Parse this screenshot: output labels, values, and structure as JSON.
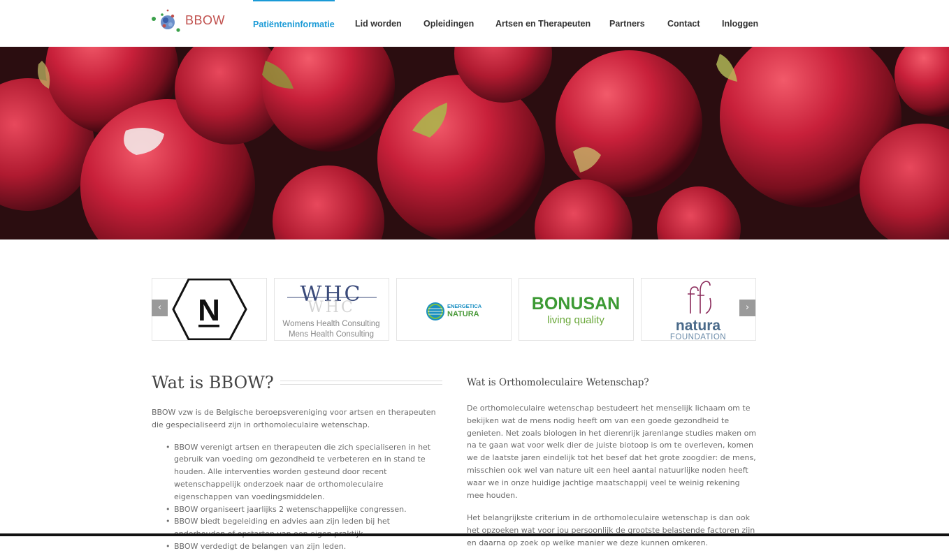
{
  "brand": {
    "name": "BBOW",
    "color": "#c0504d"
  },
  "nav": {
    "active_color": "#1a9ad6",
    "items": [
      {
        "label": "Patiënteninformatie",
        "active": true
      },
      {
        "label": "Lid worden"
      },
      {
        "label": "Opleidingen"
      },
      {
        "label": "Artsen en Therapeuten"
      },
      {
        "label": "Partners"
      },
      {
        "label": "Contact"
      },
      {
        "label": "Inloggen"
      }
    ]
  },
  "hero": {
    "subject": "red berries photo"
  },
  "carousel": {
    "prev_icon": "chevron-left-icon",
    "next_icon": "chevron-right-icon",
    "prev_label": "‹",
    "next_label": "›",
    "logos": [
      {
        "name": "N",
        "text": "N"
      },
      {
        "name": "WHC",
        "text": "WHC",
        "line1": "Womens Health Consulting",
        "line2": "Mens Health Consulting"
      },
      {
        "name": "Energetica Natura",
        "line1": "ENERGETICA",
        "line2": "NATURA"
      },
      {
        "name": "Bonusan",
        "line1": "BONUSAN",
        "line2": "living quality"
      },
      {
        "name": "Natura Foundation",
        "line1": "natura",
        "line2": "FOUNDATION"
      }
    ]
  },
  "left": {
    "title": "Wat is BBOW?",
    "intro": "BBOW vzw is de Belgische beroepsvereniging voor artsen en therapeuten die gespecialiseerd zijn in orthomoleculaire wetenschap.",
    "bullets": [
      "BBOW verenigt artsen en therapeuten die zich specialiseren in het gebruik van voeding om gezondheid te verbeteren en in stand te houden. Alle interventies worden gesteund door recent wetenschappelijk onderzoek naar de orthomoleculaire eigenschappen van voedingsmiddelen.",
      "BBOW organiseert jaarlijks 2 wetenschappelijke congressen.",
      "BBOW biedt begeleiding en advies aan zijn leden bij het onderhouden of opstarten van een eigen praktijk.",
      "BBOW verdedigt de belangen van zijn leden."
    ]
  },
  "right": {
    "title": "Wat is Orthomoleculaire Wetenschap?",
    "para1": "De orthomoleculaire wetenschap bestudeert het menselijk lichaam om te bekijken wat de mens nodig heeft om van een goede gezondheid te genieten. Net zoals biologen in het dierenrijk jarenlange studies maken om na te gaan wat voor welk dier de juiste biotoop is om te overleven, komen we de laatste jaren eindelijk tot het besef dat het grote zoogdier: de mens, misschien ook wel van nature uit een heel aantal natuurlijke noden heeft waar we in onze huidige jachtige maatschappij veel te weinig rekening mee houden.",
    "para2": "Het belangrijkste criterium in de orthomoleculaire wetenschap is dan ook het opzoeken wat voor jou persoonlijk de grootste belastende factoren zijn en daarna op zoek op welke manier we deze kunnen omkeren."
  }
}
